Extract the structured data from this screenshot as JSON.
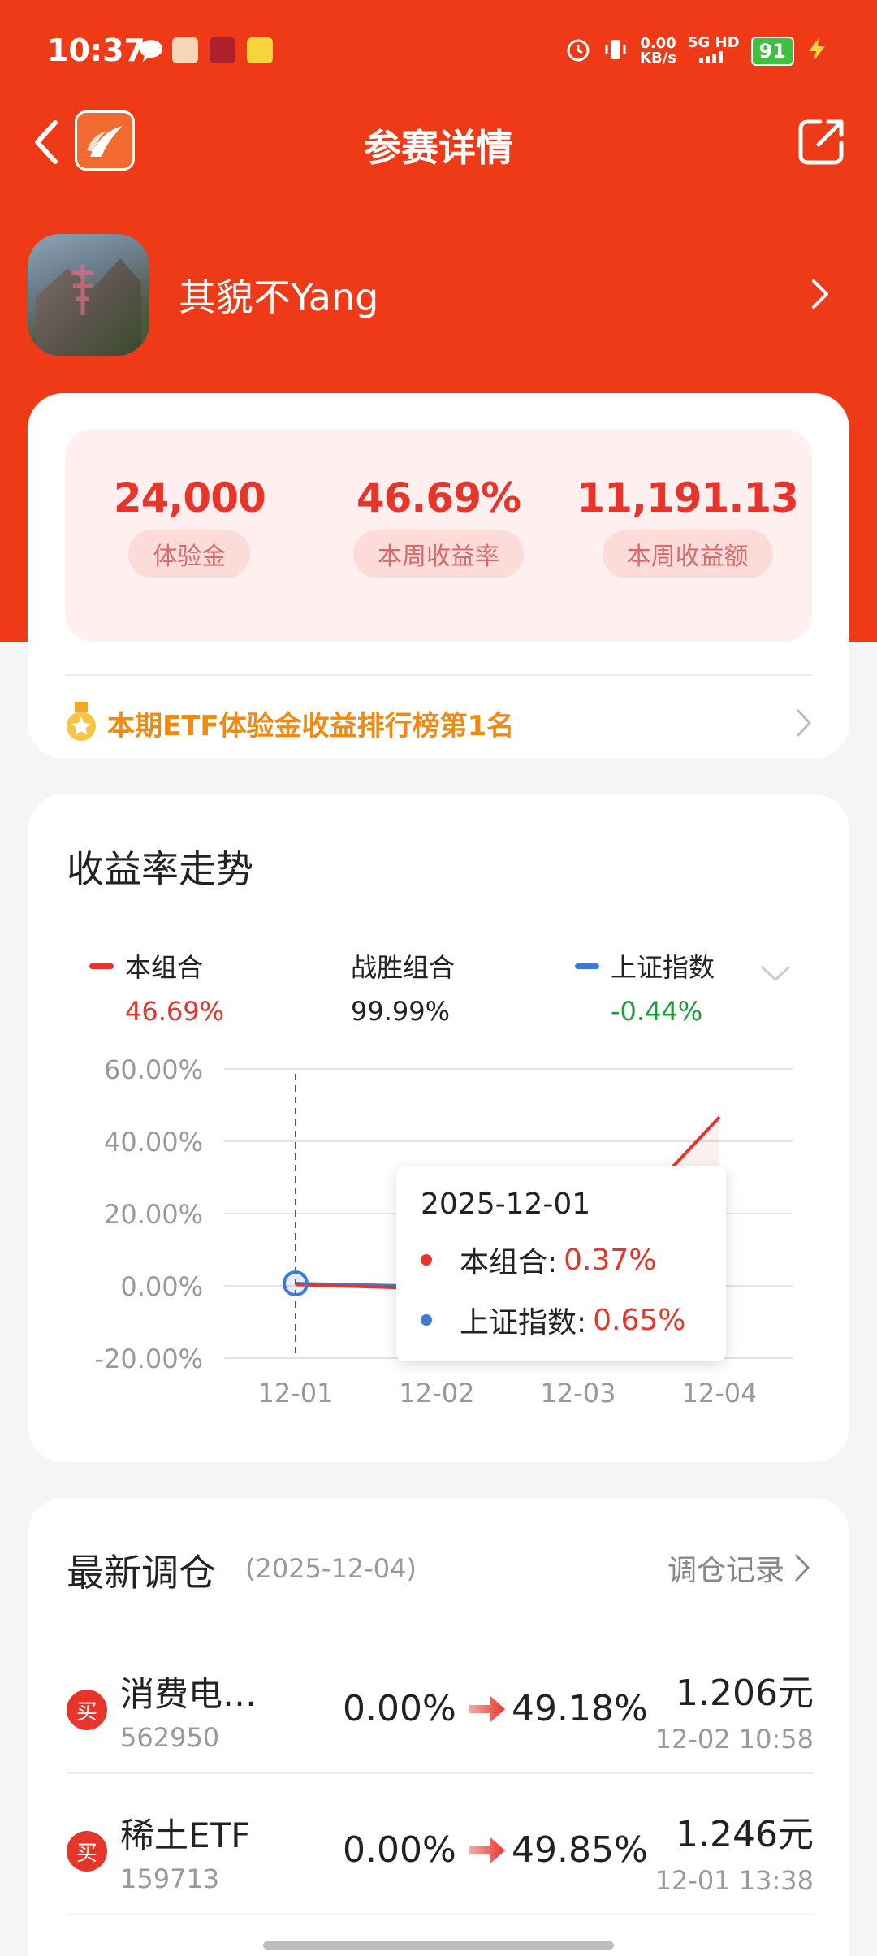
{
  "status_bar": {
    "time": "10:37",
    "net_speed_value": "0.00",
    "net_speed_unit": "KB/s",
    "network": "5G HD",
    "battery": "91",
    "icons": [
      "message-icon",
      "app-icon",
      "app-icon",
      "app-icon",
      "alarm-icon",
      "vibrate-icon",
      "signal-icon",
      "charging-icon"
    ]
  },
  "nav": {
    "title": "参赛详情",
    "back_icon": "chevron-left-icon",
    "share_icon": "share-icon"
  },
  "profile": {
    "username": "其貌不Yang"
  },
  "stats": [
    {
      "value": "24,000",
      "label": "体验金"
    },
    {
      "value": "46.69%",
      "label": "本周收益率"
    },
    {
      "value": "11,191.13",
      "label": "本周收益额"
    }
  ],
  "rank": {
    "text": "本期ETF体验金收益排行榜第1名"
  },
  "chart": {
    "title": "收益率走势",
    "legend": [
      {
        "name": "本组合",
        "value": "46.69%",
        "color": "#e8352c",
        "value_color": "#e8352c"
      },
      {
        "name": "战胜组合",
        "value": "99.99%",
        "color": "",
        "value_color": "#222222"
      },
      {
        "name": "上证指数",
        "value": "-0.44%",
        "color": "#3a7bd5",
        "value_color": "#1e9a3a"
      }
    ],
    "tooltip": {
      "date": "2025-12-01",
      "rows": [
        {
          "label": "本组合:",
          "value": "0.37%",
          "color": "#e8352c"
        },
        {
          "label": "上证指数:",
          "value": "0.65%",
          "color": "#3a7bd5"
        }
      ]
    }
  },
  "chart_data": {
    "type": "line",
    "title": "收益率走势",
    "x": [
      "12-01",
      "12-02",
      "12-03",
      "12-04"
    ],
    "yticks": [
      "60.00%",
      "40.00%",
      "20.00%",
      "0.00%",
      "-20.00%"
    ],
    "ylim": [
      -20,
      60
    ],
    "grid": true,
    "series": [
      {
        "name": "本组合",
        "color": "#e8352c",
        "values": [
          0.37,
          -0.8,
          5.0,
          46.69
        ]
      },
      {
        "name": "上证指数",
        "color": "#3a7bd5",
        "values": [
          0.65,
          -0.2,
          -0.3,
          -0.44
        ]
      }
    ],
    "selected_x": "12-01"
  },
  "rebalance": {
    "title": "最新调仓",
    "date": "(2025-12-04)",
    "link": "调仓记录",
    "trades": [
      {
        "badge": "买",
        "name": "消费电…",
        "code": "562950",
        "from": "0.00%",
        "to": "49.18%",
        "price": "1.206元",
        "time": "12-02 10:58"
      },
      {
        "badge": "买",
        "name": "稀土ETF",
        "code": "159713",
        "from": "0.00%",
        "to": "49.85%",
        "price": "1.246元",
        "time": "12-01 13:38"
      }
    ]
  }
}
